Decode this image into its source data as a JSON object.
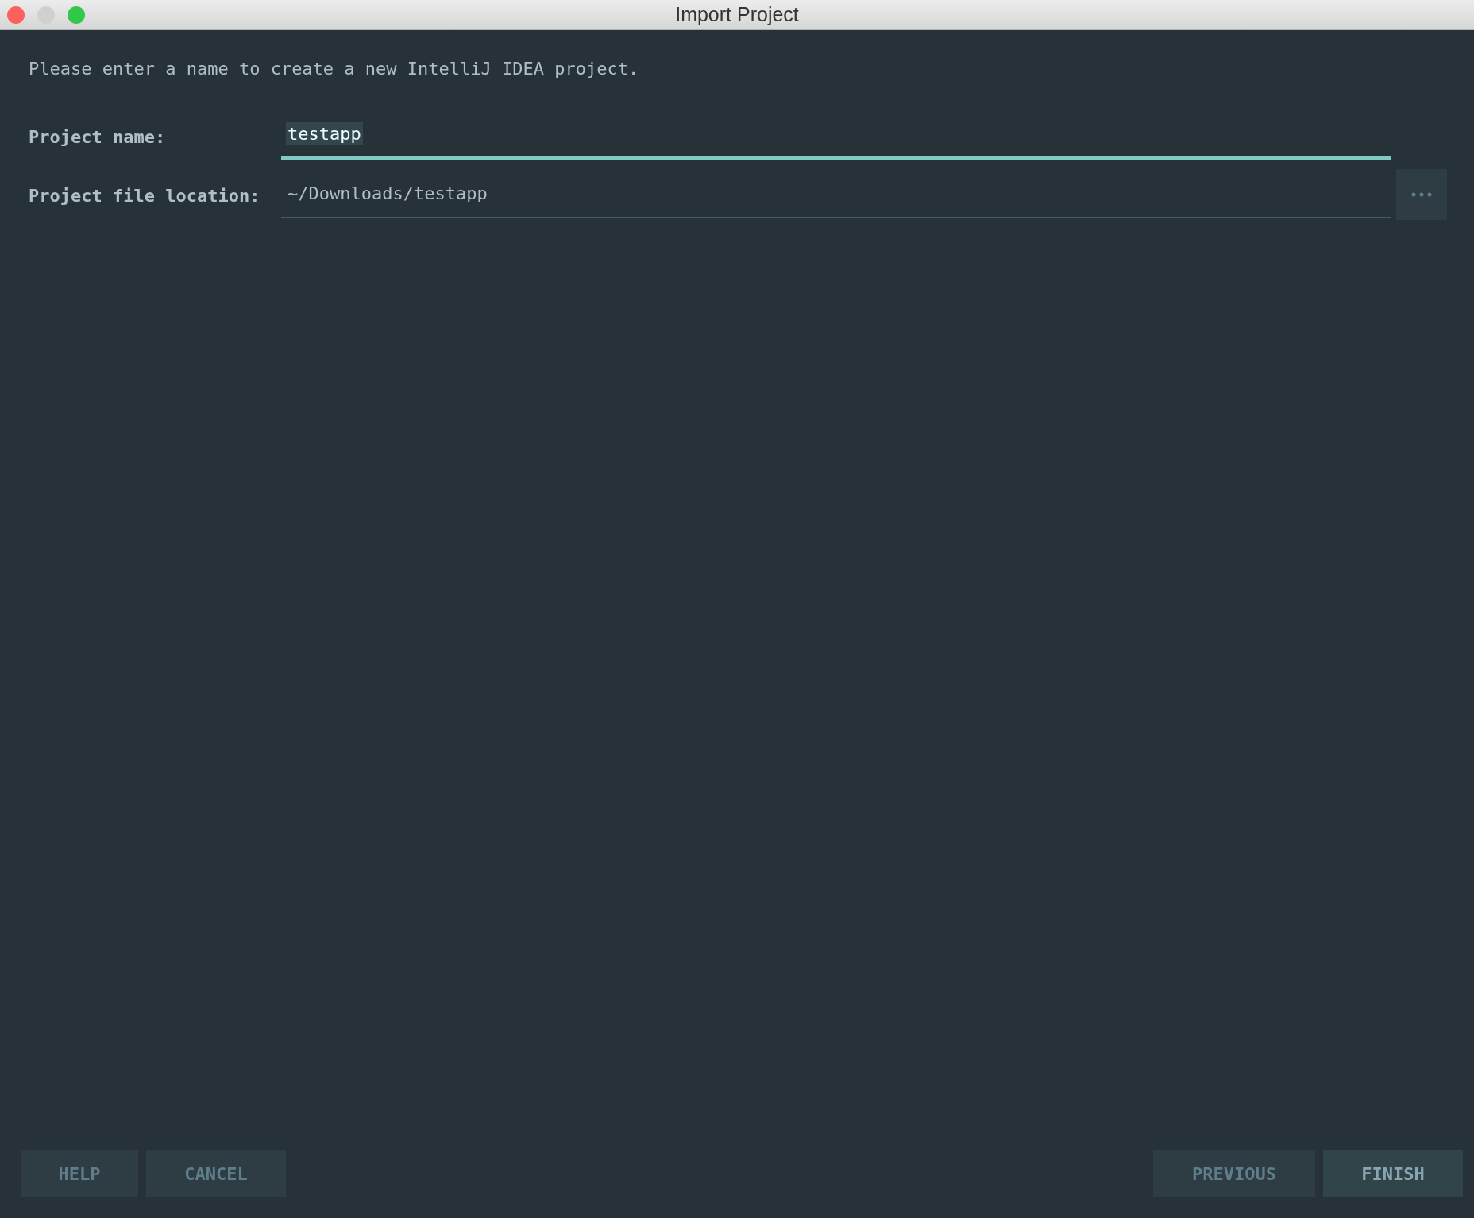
{
  "window": {
    "title": "Import Project"
  },
  "intro": "Please enter a name to create a new IntelliJ IDEA project.",
  "fields": [
    {
      "label": "Project name:",
      "value": "testapp",
      "focused": true,
      "has_browse": false
    },
    {
      "label": "Project file location:",
      "value": "~/Downloads/testapp",
      "focused": false,
      "has_browse": true
    }
  ],
  "buttons_left": [
    {
      "label": "HELP",
      "primary": false
    },
    {
      "label": "CANCEL",
      "primary": false
    }
  ],
  "buttons_right": [
    {
      "label": "PREVIOUS",
      "primary": false
    },
    {
      "label": "FINISH",
      "primary": true
    }
  ]
}
